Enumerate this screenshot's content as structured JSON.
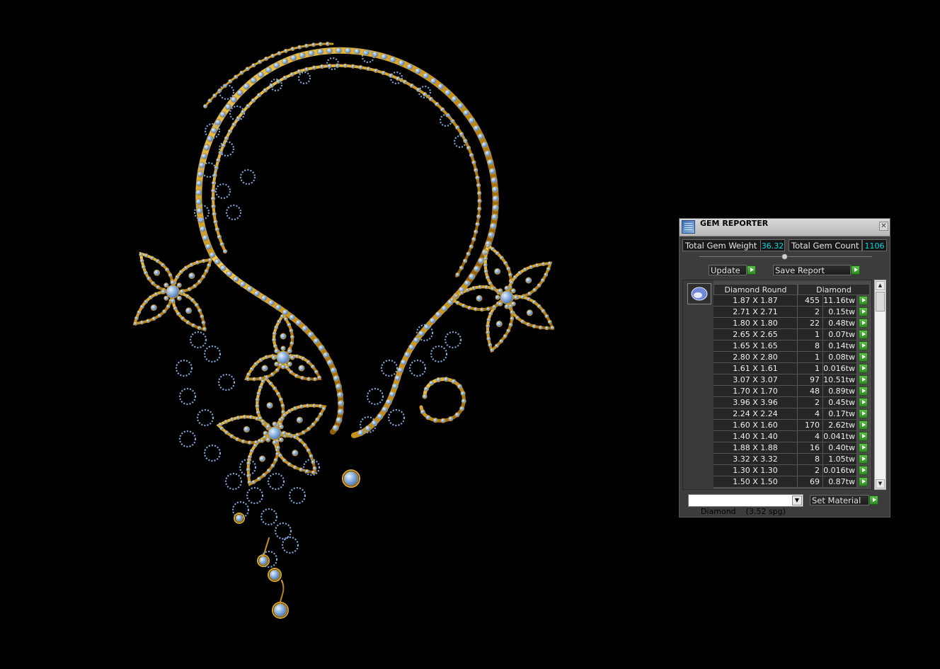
{
  "window": {
    "title": "GEM REPORTER",
    "close_glyph": "✕"
  },
  "stats": {
    "total_weight_label": "Total Gem Weight",
    "total_weight_value": "36.32",
    "total_count_label": "Total Gem Count",
    "total_count_value": "1106"
  },
  "actions": {
    "update_label": "Update",
    "save_report_label": "Save Report",
    "set_material_label": "Set Material"
  },
  "table": {
    "shape_header": "Diamond Round",
    "material_header": "Diamond",
    "gem_icon": "gem-round-icon",
    "rows": [
      {
        "size": "1.87 X 1.87",
        "count": "455",
        "weight": "11.16tw"
      },
      {
        "size": "2.71 X 2.71",
        "count": "2",
        "weight": "0.15tw"
      },
      {
        "size": "1.80 X 1.80",
        "count": "22",
        "weight": "0.48tw"
      },
      {
        "size": "2.65 X 2.65",
        "count": "1",
        "weight": "0.07tw"
      },
      {
        "size": "1.65 X 1.65",
        "count": "8",
        "weight": "0.14tw"
      },
      {
        "size": "2.80 X 2.80",
        "count": "1",
        "weight": "0.08tw"
      },
      {
        "size": "1.61 X 1.61",
        "count": "1",
        "weight": "0.016tw"
      },
      {
        "size": "3.07 X 3.07",
        "count": "97",
        "weight": "10.51tw"
      },
      {
        "size": "1.70 X 1.70",
        "count": "48",
        "weight": "0.89tw"
      },
      {
        "size": "3.96 X 3.96",
        "count": "2",
        "weight": "0.45tw"
      },
      {
        "size": "2.24 X 2.24",
        "count": "4",
        "weight": "0.17tw"
      },
      {
        "size": "1.60 X 1.60",
        "count": "170",
        "weight": "2.62tw"
      },
      {
        "size": "1.40 X 1.40",
        "count": "4",
        "weight": "0.041tw"
      },
      {
        "size": "1.88 X 1.88",
        "count": "16",
        "weight": "0.40tw"
      },
      {
        "size": "3.32 X 3.32",
        "count": "8",
        "weight": "1.05tw"
      },
      {
        "size": "1.30 X 1.30",
        "count": "2",
        "weight": "0.016tw"
      },
      {
        "size": "1.50 X 1.50",
        "count": "69",
        "weight": "0.87tw"
      }
    ]
  },
  "material": {
    "selected": "Diamond    (3.52 spg)",
    "arrow_glyph": "▼"
  },
  "scroll": {
    "up_glyph": "▲",
    "down_glyph": "▼"
  },
  "colors": {
    "gold": "#d4a530",
    "gem_blue": "#8ab0e0",
    "value_cyan": "#00d8e8",
    "go_green": "#3aa02c"
  }
}
